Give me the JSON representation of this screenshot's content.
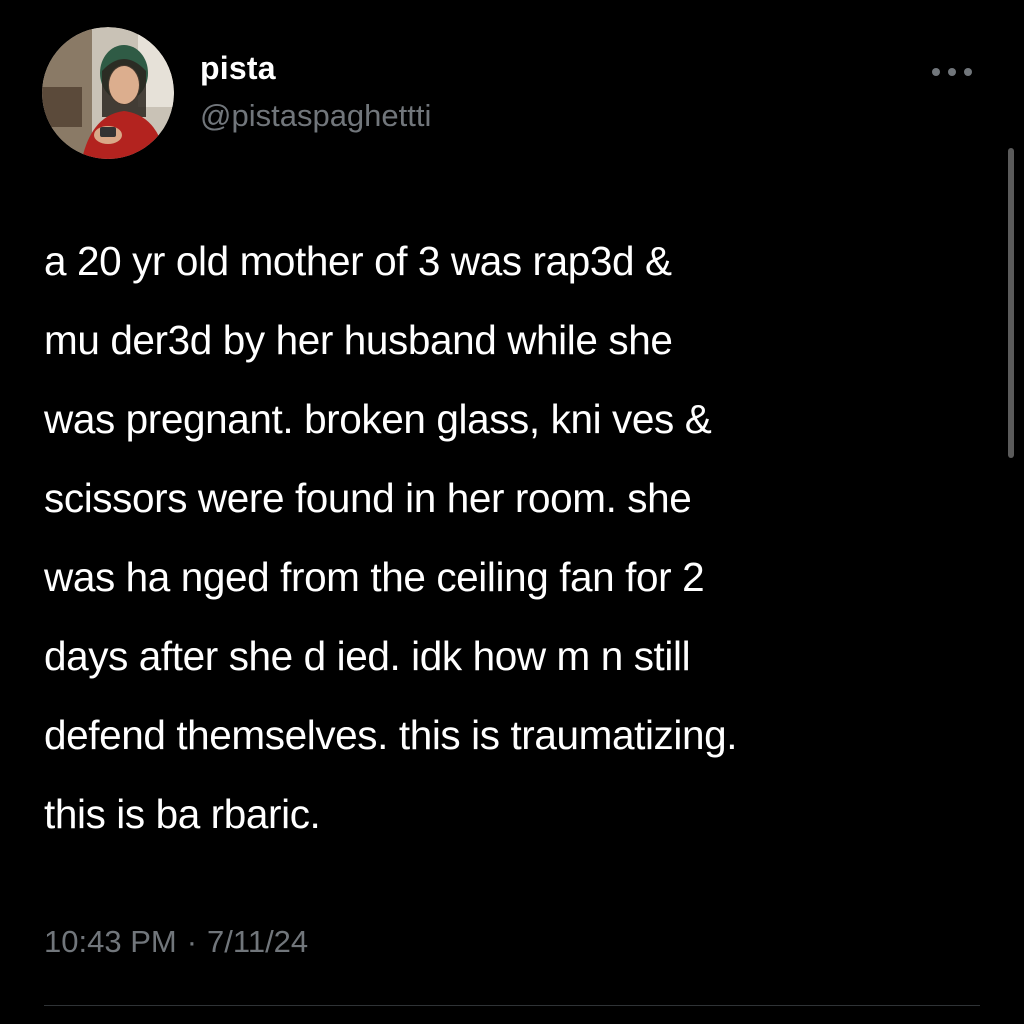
{
  "author": {
    "display_name": "pista",
    "handle": "@pistaspaghettti",
    "avatar_icon": "profile-photo-avatar"
  },
  "post": {
    "text": "a 20 yr old mother of 3 was rap3d &\nmu der3d by her husband while she\nwas pregnant. broken glass, kni ves &\nscissors were found in her room. she\nwas ha nged from the ceiling fan for 2\ndays after she d ied. idk how m n still\ndefend themselves. this is traumatizing.\nthis is ba rbaric."
  },
  "meta": {
    "time": "10:43 PM",
    "separator": "·",
    "date": "7/11/24"
  },
  "icons": {
    "more": "more-horizontal-icon"
  },
  "colors": {
    "background": "#000000",
    "text_primary": "#ffffff",
    "text_secondary": "#71767b",
    "divider": "#2f3336"
  }
}
